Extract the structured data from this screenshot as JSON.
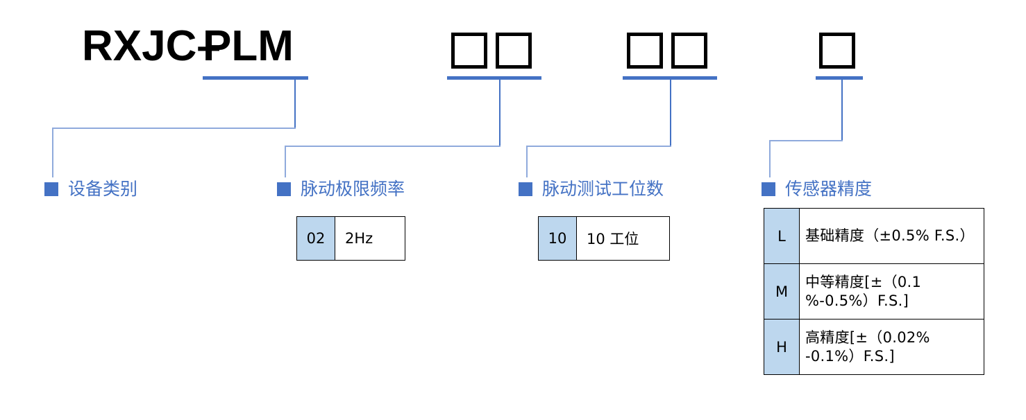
{
  "model": {
    "prefix": "RXJC–",
    "segment_device": "PLM",
    "placeholder_groups": [
      {
        "name": "frequency",
        "count": 2
      },
      {
        "name": "stations",
        "count": 2
      },
      {
        "name": "accuracy",
        "count": 1
      }
    ]
  },
  "categories": [
    {
      "id": "device-type",
      "label": "设备类别"
    },
    {
      "id": "pulsation-frequency",
      "label": "脉动极限频率"
    },
    {
      "id": "pulsation-stations",
      "label": "脉动测试工位数"
    },
    {
      "id": "sensor-accuracy",
      "label": "传感器精度"
    }
  ],
  "tables": {
    "frequency": {
      "rows": [
        {
          "code": "02",
          "desc": "2Hz"
        }
      ]
    },
    "stations": {
      "rows": [
        {
          "code": "10",
          "desc": "10 工位"
        }
      ]
    },
    "accuracy": {
      "rows": [
        {
          "code": "L",
          "desc": "基础精度（±0.5% F.S.）"
        },
        {
          "code": "M",
          "desc": "中等精度[±（0.1 %-0.5%）F.S.]"
        },
        {
          "code": "H",
          "desc": "高精度[±（0.02% -0.1%）F.S.]"
        }
      ]
    }
  },
  "colors": {
    "accent_blue": "#4472C4",
    "leader_blue": "#8FAADC",
    "code_cell_bg": "#BDD7EE",
    "text_black": "#000000",
    "background": "#FFFFFF"
  }
}
